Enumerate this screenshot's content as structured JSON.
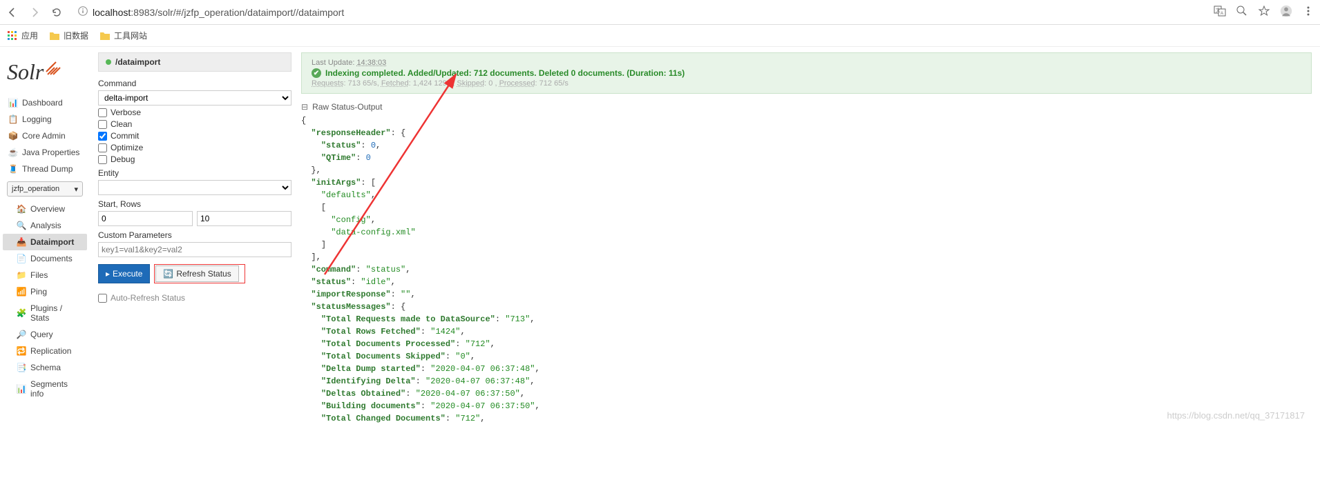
{
  "browser": {
    "url_host": "localhost",
    "url_port": ":8983",
    "url_path": "/solr/#/jzfp_operation/dataimport//dataimport"
  },
  "bookmarks": {
    "apps": "应用",
    "b1": "旧数据",
    "b2": "工具网站"
  },
  "sidebar": {
    "dashboard": "Dashboard",
    "logging": "Logging",
    "coreadmin": "Core Admin",
    "javaprops": "Java Properties",
    "threaddump": "Thread Dump",
    "core": "jzfp_operation",
    "overview": "Overview",
    "analysis": "Analysis",
    "dataimport": "Dataimport",
    "documents": "Documents",
    "files": "Files",
    "ping": "Ping",
    "plugins": "Plugins / Stats",
    "query": "Query",
    "replication": "Replication",
    "schema": "Schema",
    "segments": "Segments info"
  },
  "breadcrumb": "/dataimport",
  "form": {
    "command_label": "Command",
    "command_value": "delta-import",
    "verbose": "Verbose",
    "clean": "Clean",
    "commit": "Commit",
    "optimize": "Optimize",
    "debug": "Debug",
    "entity_label": "Entity",
    "startrows_label": "Start, Rows",
    "start_value": "0",
    "rows_value": "10",
    "custom_label": "Custom Parameters",
    "custom_placeholder": "key1=val1&key2=val2",
    "execute": "Execute",
    "refresh": "Refresh Status",
    "autorefresh": "Auto-Refresh Status"
  },
  "status": {
    "last_update_label": "Last Update: ",
    "last_update_time": "14:38:03",
    "main": "Indexing completed. Added/Updated: 712 documents. Deleted 0 documents. (Duration: 11s)",
    "requests_label": "Requests",
    "requests_val": ": 713 65/s, ",
    "fetched_label": "Fetched",
    "fetched_val": ": 1,424 129/s, ",
    "skipped_label": "Skipped",
    "skipped_val": ": 0 , ",
    "processed_label": "Processed",
    "processed_val": ": 712 65/s",
    "raw_header": "Raw Status-Output"
  },
  "raw": {
    "status": "0",
    "qtime": "0",
    "config": "config",
    "dataconfig": "data-config.xml",
    "command": "status",
    "status_val": "idle",
    "importresponse": "",
    "total_requests": "713",
    "total_fetched": "1424",
    "total_processed": "712",
    "total_skipped": "0",
    "delta_dump": "2020-04-07 06:37:48",
    "identifying": "2020-04-07 06:37:48",
    "deltas_obtained": "2020-04-07 06:37:50",
    "building": "2020-04-07 06:37:50",
    "total_changed": "712"
  },
  "watermark": "https://blog.csdn.net/qq_37171817"
}
